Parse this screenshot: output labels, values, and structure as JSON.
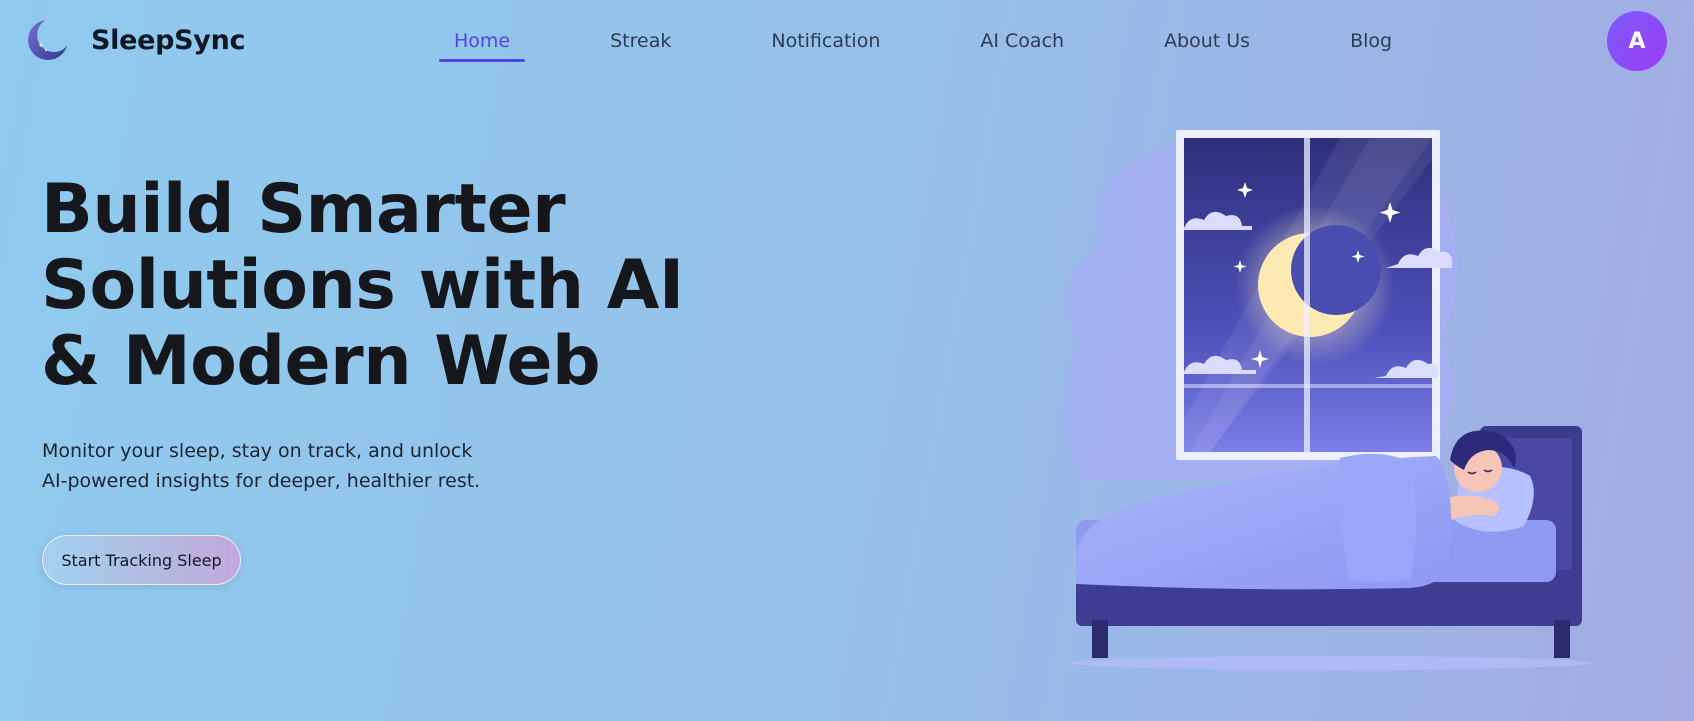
{
  "header": {
    "brand": "SleepSync",
    "nav": [
      {
        "label": "Home",
        "active": true
      },
      {
        "label": "Streak",
        "active": false
      },
      {
        "label": "Notification",
        "active": false
      },
      {
        "label": "AI Coach",
        "active": false
      },
      {
        "label": "About Us",
        "active": false
      },
      {
        "label": "Blog",
        "active": false
      }
    ],
    "avatar_initial": "A"
  },
  "hero": {
    "title_lines": [
      "Build Smarter",
      "Solutions with AI",
      "& Modern Web"
    ],
    "subtitle_lines": [
      "Monitor your sleep, stay on track, and unlock",
      "AI-powered insights for deeper, healthier rest."
    ],
    "cta_label": "Start Tracking Sleep"
  },
  "colors": {
    "accent": "#4f46e5",
    "avatar_gradient": [
      "#7c5cf6",
      "#9a3cf5"
    ],
    "background_gradient": [
      "#8fcbee",
      "#a4abe2"
    ]
  },
  "icons": {
    "logo": "crescent-moon-logo-icon",
    "illustration": "sleeping-person-window-moon-illustration"
  }
}
